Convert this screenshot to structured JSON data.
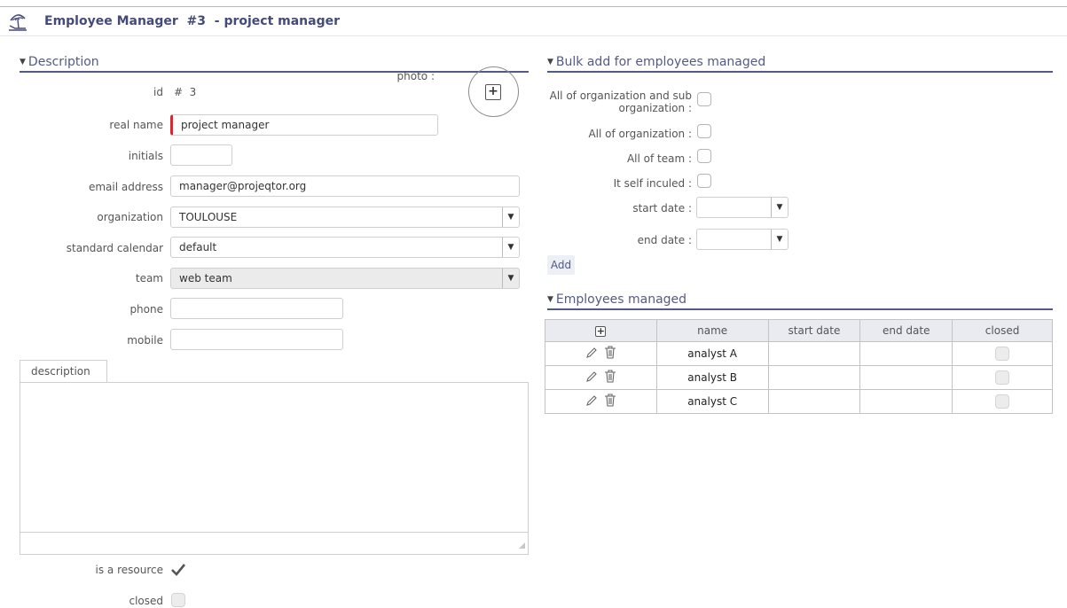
{
  "header": {
    "title": "Employee Manager  #3  - project manager",
    "icon": "employee-manager-icon"
  },
  "description_section": {
    "title": "Description",
    "photo_label": "photo :",
    "id_label": "id",
    "id_value": "#  3",
    "real_name_label": "real name",
    "real_name_value": "project manager",
    "initials_label": "initials",
    "initials_value": "",
    "email_label": "email address",
    "email_value": "manager@projeqtor.org",
    "organization_label": "organization",
    "organization_value": "TOULOUSE",
    "calendar_label": "standard calendar",
    "calendar_value": "default",
    "team_label": "team",
    "team_value": "web team",
    "phone_label": "phone",
    "phone_value": "",
    "mobile_label": "mobile",
    "mobile_value": "",
    "description_tab": "description",
    "description_value": "",
    "is_resource_label": "is a resource",
    "is_resource_checked": true,
    "closed_label": "closed",
    "closed_checked": false
  },
  "bulk_section": {
    "title": "Bulk add for employees managed",
    "org_and_sub_label_line1": "All of organization and sub",
    "org_and_sub_label_line2": "organization :",
    "org_label": "All of organization :",
    "team_label": "All of team :",
    "self_label": "It self inculed :",
    "start_date_label": "start date :",
    "start_date_value": "",
    "end_date_label": "end date :",
    "end_date_value": "",
    "add_button": "Add"
  },
  "employees_section": {
    "title": "Employees managed",
    "columns": [
      "name",
      "start date",
      "end date",
      "closed"
    ],
    "rows": [
      {
        "name": "analyst A",
        "start_date": "",
        "end_date": "",
        "closed": false
      },
      {
        "name": "analyst B",
        "start_date": "",
        "end_date": "",
        "closed": false
      },
      {
        "name": "analyst C",
        "start_date": "",
        "end_date": "",
        "closed": false
      }
    ]
  },
  "colors": {
    "accent": "#545a86",
    "title": "#444a7a",
    "required": "#e0232d"
  }
}
